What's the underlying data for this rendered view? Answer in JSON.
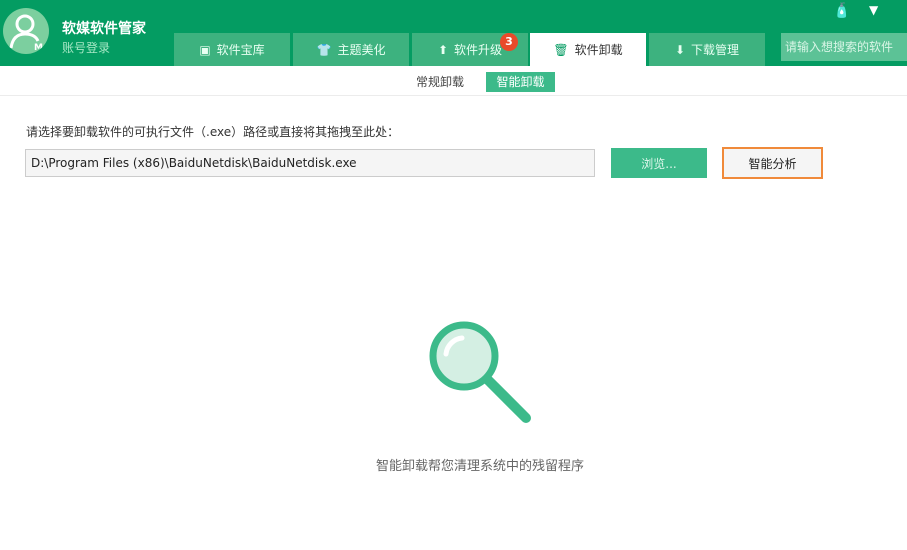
{
  "header": {
    "app_title": "软媒软件管家",
    "login": "账号登录",
    "avatar_badge": "M",
    "search_placeholder": "请输入想搜索的软件"
  },
  "tabs": [
    {
      "label": "软件宝库",
      "icon": "store-icon"
    },
    {
      "label": "主题美化",
      "icon": "tshirt-icon"
    },
    {
      "label": "软件升级",
      "icon": "upgrade-icon",
      "badge": "3"
    },
    {
      "label": "软件卸载",
      "icon": "trash-icon",
      "active": true
    },
    {
      "label": "下载管理",
      "icon": "download-icon"
    }
  ],
  "subtabs": [
    {
      "label": "常规卸载"
    },
    {
      "label": "智能卸载",
      "active": true
    }
  ],
  "main": {
    "prompt": "请选择要卸载软件的可执行文件（.exe）路径或直接将其拖拽至此处：",
    "path_value": "D:\\Program Files (x86)\\BaiduNetdisk\\BaiduNetdisk.exe",
    "browse_label": "浏览...",
    "analyze_label": "智能分析",
    "caption": "智能卸载帮您清理系统中的残留程序"
  },
  "colors": {
    "brand": "#049c62",
    "accent": "#3cba8a",
    "highlight": "#f08a3a"
  }
}
